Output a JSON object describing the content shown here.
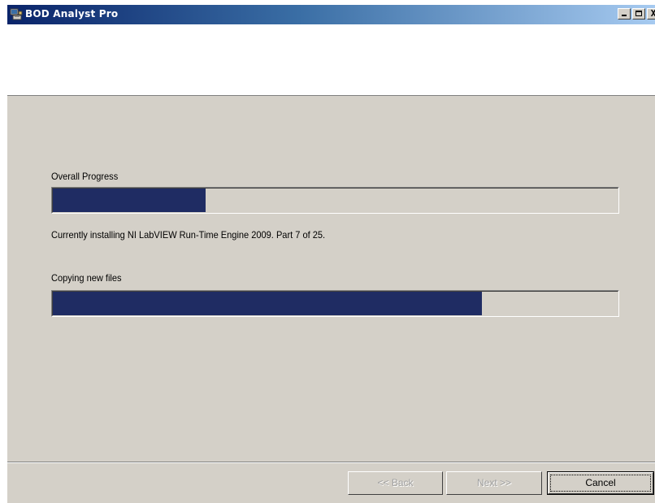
{
  "window": {
    "title": "BOD Analyst Pro",
    "app_icon": "computer-app-icon",
    "controls": {
      "minimize_icon": "minimize-icon",
      "maximize_icon": "maximize-icon",
      "close_label": "X",
      "close_icon": "close-icon"
    }
  },
  "install": {
    "overall_label": "Overall Progress",
    "overall_progress": 0.27,
    "status_text": "Currently installing NI LabVIEW Run-Time Engine 2009.  Part 7 of 25.",
    "step_label": "Copying new files",
    "step_progress": 0.76
  },
  "buttons": {
    "back_label": "<< Back",
    "next_label": "Next >>",
    "cancel_label": "Cancel"
  },
  "colors": {
    "progress_fill": "#1f2c63",
    "title_bar_start": "#0a246a",
    "title_bar_end": "#a6caf0",
    "dialog_background": "#d4d0c8"
  }
}
